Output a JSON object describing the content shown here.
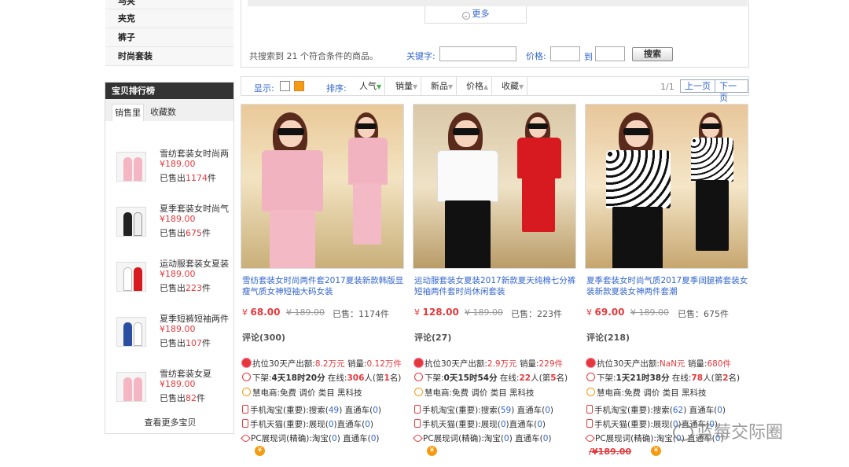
{
  "categories": [
    {
      "label": "马夹"
    },
    {
      "label": "夹克"
    },
    {
      "label": "裤子"
    },
    {
      "label": "时尚套装"
    }
  ],
  "ranking": {
    "title": "宝贝排行榜",
    "tabs": [
      "销售里",
      "收藏数"
    ],
    "items": [
      {
        "name": "雪纺套装女时尚两",
        "price": "¥189.00",
        "sold_prefix": "已售出",
        "sold": "1174",
        "sold_suffix": "件"
      },
      {
        "name": "夏季套装女时尚气",
        "price": "¥189.00",
        "sold_prefix": "已售出",
        "sold": "675",
        "sold_suffix": "件"
      },
      {
        "name": "运动服套装女夏装",
        "price": "¥189.00",
        "sold_prefix": "已售出",
        "sold": "223",
        "sold_suffix": "件"
      },
      {
        "name": "夏季短裤短袖两件",
        "price": "¥189.00",
        "sold_prefix": "已售出",
        "sold": "107",
        "sold_suffix": "件"
      },
      {
        "name": "雪纺套装女夏",
        "price": "¥189.00",
        "sold_prefix": "已售出",
        "sold": "82",
        "sold_suffix": "件"
      }
    ],
    "more": "查看更多宝贝"
  },
  "search": {
    "more_label": "更多",
    "count_text": "共搜索到 21 个符合条件的商品。",
    "keyword_label": "关键字:",
    "price_label": "价格:",
    "to_label": "到",
    "button": "搜索"
  },
  "sortbar": {
    "display_label": "显示:",
    "sort_label": "排序:",
    "sorts": [
      "人气",
      "销量",
      "新品",
      "价格",
      "收藏"
    ],
    "page_info": "1/1",
    "prev": "上一页",
    "next": "下一页"
  },
  "products": [
    {
      "title": "雪纺套装女时尚两件套2017夏装新款韩版显瘦气质女神短袖大码女装",
      "price": "68.00",
      "old_price": "¥ 189.00",
      "sold": "已售：1174件",
      "reviews": "评论(300)",
      "line1": {
        "a": "抗位30天产出额:",
        "v1": "8.2万元",
        "b": " 销量:",
        "v2": "0.12万件"
      },
      "line2": {
        "a": "下架:",
        "v1": "4天18时20分",
        "b": " 在线:",
        "v2": "306",
        "c": "人(第",
        "v3": "1",
        "d": "名)"
      },
      "line3": "慧电商:免费 调价 类目 黑科技",
      "line4": {
        "a": "手机淘宝(重要):搜索(",
        "v1": "49",
        "b": ") 直通车(",
        "v2": "0",
        "c": ")"
      },
      "line5": {
        "a": "手机天猫(重要):展现(",
        "v1": "0",
        "b": ")直通车(",
        "v2": "0",
        "c": ")"
      },
      "line6": {
        "a": "PC展现词(精确):淘宝(",
        "v1": "0",
        "b": ") 直通车(",
        "v2": "0",
        "c": ")"
      },
      "extra": ""
    },
    {
      "title": "运动服套装女夏装2017新款夏天纯棉七分裤短袖两件套时尚休闲套装",
      "price": "128.00",
      "old_price": "¥ 189.00",
      "sold": "已售：223件",
      "reviews": "评论(27)",
      "line1": {
        "a": "抗位30天产出额:",
        "v1": "2.9万元",
        "b": " 销量:",
        "v2": "229件"
      },
      "line2": {
        "a": "下架:",
        "v1": "0天15时54分",
        "b": " 在线:",
        "v2": "22",
        "c": "人(第",
        "v3": "5",
        "d": "名)"
      },
      "line3": "慧电商:免费 调价 类目 黑科技",
      "line4": {
        "a": "手机淘宝(重要):搜索(",
        "v1": "59",
        "b": ") 直通车(",
        "v2": "0",
        "c": ")"
      },
      "line5": {
        "a": "手机天猫(重要):展现(",
        "v1": "0",
        "b": ")直通车(",
        "v2": "0",
        "c": ")"
      },
      "line6": {
        "a": "PC展现词(精确):淘宝(",
        "v1": "0",
        "b": ") 直通车(",
        "v2": "0",
        "c": ")"
      },
      "extra": ""
    },
    {
      "title": "夏季套装女时尚气质2017夏季阔腿裤套装女装新款夏装女神两件套潮",
      "price": "69.00",
      "old_price": "¥ 189.00",
      "sold": "已售：675件",
      "reviews": "评论(218)",
      "line1": {
        "a": "抗位30天产出额:",
        "v1": "NaN元",
        "b": " 销量:",
        "v2": "680件"
      },
      "line2": {
        "a": "下架:",
        "v1": "1天21时38分",
        "b": " 在线:",
        "v2": "78",
        "c": "人(第",
        "v3": "2",
        "d": "名)"
      },
      "line3": "慧电商:免费 调价 类目 黑科技",
      "line4": {
        "a": "手机淘宝(重要):搜索(",
        "v1": "62",
        "b": ") 直通车(",
        "v2": "0",
        "c": ")"
      },
      "line5": {
        "a": "手机天猫(重要):展现(",
        "v1": "0",
        "b": ")直通车(",
        "v2": "0",
        "c": ")"
      },
      "line6": {
        "a": "PC展现词(精确):淘宝(",
        "v1": "0",
        "b": ") 直通车(",
        "v2": "0",
        "c": ")"
      },
      "extra": "/¥189.00"
    }
  ],
  "currency_symbol": "¥",
  "coin_glyph": "¥",
  "watermark": "蓝莓交际圈",
  "colors": {
    "price_red": "#e4393c",
    "link_blue": "#3366cc",
    "rank_header": "#333333"
  }
}
